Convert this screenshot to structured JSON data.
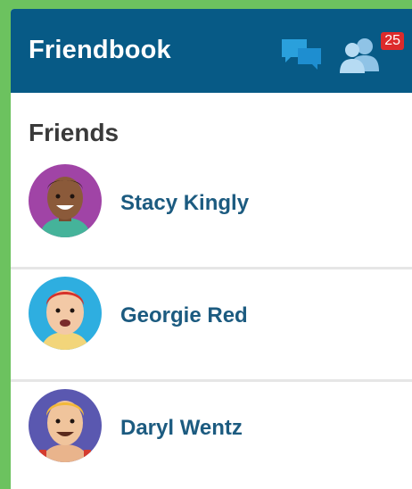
{
  "header": {
    "title": "Friendbook",
    "messages_icon": "chat-bubbles-icon",
    "friend_requests_icon": "friends-icon",
    "friend_requests_count": "25",
    "background": "#075a86"
  },
  "section": {
    "title": "Friends"
  },
  "friends": [
    {
      "name": "Stacy Kingly",
      "avatar_bg": "#a044a6"
    },
    {
      "name": "Georgie Red",
      "avatar_bg": "#2eaee0"
    },
    {
      "name": "Daryl Wentz",
      "avatar_bg": "#5a58b0"
    }
  ],
  "colors": {
    "page_bg": "#6cc25f",
    "name_text": "#1c5b80",
    "badge": "#dd2b2b"
  }
}
